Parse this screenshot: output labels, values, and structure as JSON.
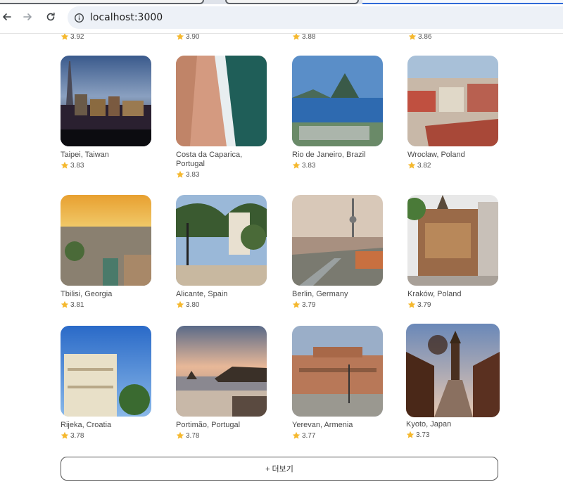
{
  "browser": {
    "url": "localhost:3000"
  },
  "top_partial_ratings": [
    "3.92",
    "3.90",
    "3.88",
    "3.86"
  ],
  "cities": [
    {
      "name": "Taipei, Taiwan",
      "rating": "3.83"
    },
    {
      "name": "Costa da Caparica, Portugal",
      "rating": "3.83"
    },
    {
      "name": "Rio de Janeiro, Brazil",
      "rating": "3.83"
    },
    {
      "name": "Wrocław, Poland",
      "rating": "3.82"
    },
    {
      "name": "Tbilisi, Georgia",
      "rating": "3.81"
    },
    {
      "name": "Alicante, Spain",
      "rating": "3.80"
    },
    {
      "name": "Berlin, Germany",
      "rating": "3.79"
    },
    {
      "name": "Kraków, Poland",
      "rating": "3.79"
    },
    {
      "name": "Rijeka, Croatia",
      "rating": "3.78"
    },
    {
      "name": "Portimão, Portugal",
      "rating": "3.78"
    },
    {
      "name": "Yerevan, Armenia",
      "rating": "3.77"
    },
    {
      "name": "Kyoto, Japan",
      "rating": "3.73"
    }
  ],
  "load_more_label": "+ 더보기",
  "colors": {
    "star": "#f5b82e",
    "button_border": "#555555"
  },
  "icons": {
    "back": "arrow-left-icon",
    "forward": "arrow-right-icon",
    "reload": "reload-icon",
    "info": "info-icon",
    "rating": "star-icon"
  }
}
